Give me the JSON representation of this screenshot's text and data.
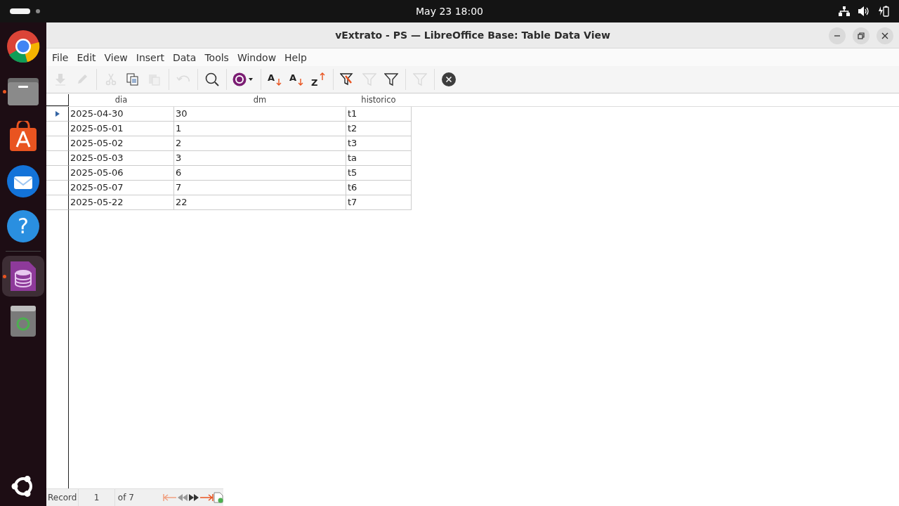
{
  "topbar": {
    "clock": "May 23  18:00"
  },
  "dock": [
    {
      "kind": "browser",
      "running": false,
      "selected": false
    },
    {
      "kind": "files",
      "running": true,
      "selected": false
    },
    {
      "kind": "store",
      "running": false,
      "selected": false
    },
    {
      "kind": "mail",
      "running": false,
      "selected": false
    },
    {
      "kind": "help",
      "running": false,
      "selected": false,
      "glyph": "?"
    },
    {
      "kind": "base",
      "running": true,
      "selected": true
    },
    {
      "kind": "trash",
      "running": false,
      "selected": false
    }
  ],
  "window": {
    "title": "vExtrato - PS — LibreOffice Base: Table Data View"
  },
  "menu": [
    "File",
    "Edit",
    "View",
    "Insert",
    "Data",
    "Tools",
    "Window",
    "Help"
  ],
  "toolbar": [
    {
      "kind": "save",
      "disabled": true
    },
    {
      "kind": "edit",
      "disabled": true
    },
    {
      "kind": "sep"
    },
    {
      "kind": "cut",
      "disabled": true
    },
    {
      "kind": "copy",
      "disabled": false
    },
    {
      "kind": "paste",
      "disabled": true
    },
    {
      "kind": "sep"
    },
    {
      "kind": "undo",
      "disabled": true
    },
    {
      "kind": "sep"
    },
    {
      "kind": "find",
      "disabled": false
    },
    {
      "kind": "sep"
    },
    {
      "kind": "refresh",
      "disabled": false
    },
    {
      "kind": "sep"
    },
    {
      "kind": "sortasc",
      "disabled": false,
      "glyph": "A"
    },
    {
      "kind": "sortdesc",
      "disabled": false,
      "glyph": "A"
    },
    {
      "kind": "sort",
      "disabled": false,
      "glyph": "Z"
    },
    {
      "kind": "sep"
    },
    {
      "kind": "autofilter",
      "disabled": false
    },
    {
      "kind": "filterapply",
      "disabled": true
    },
    {
      "kind": "filter",
      "disabled": false
    },
    {
      "kind": "sep"
    },
    {
      "kind": "filterremove",
      "disabled": true
    },
    {
      "kind": "sep"
    },
    {
      "kind": "close",
      "disabled": false
    }
  ],
  "table": {
    "columns": [
      "dia",
      "dm",
      "historico"
    ],
    "rows": [
      {
        "cells": [
          "2025-04-30",
          "30",
          "t1"
        ],
        "selected": true
      },
      {
        "cells": [
          "2025-05-01",
          "1",
          "t2"
        ],
        "selected": false
      },
      {
        "cells": [
          "2025-05-02",
          "2",
          "t3"
        ],
        "selected": false
      },
      {
        "cells": [
          "2025-05-03",
          "3",
          "ta"
        ],
        "selected": false
      },
      {
        "cells": [
          "2025-05-06",
          "6",
          "t5"
        ],
        "selected": false
      },
      {
        "cells": [
          "2025-05-07",
          "7",
          "t6"
        ],
        "selected": false
      },
      {
        "cells": [
          "2025-05-22",
          "22",
          "t7"
        ],
        "selected": false
      }
    ]
  },
  "status_bar": {
    "label": "Record",
    "record": "1",
    "total": "of 7"
  }
}
